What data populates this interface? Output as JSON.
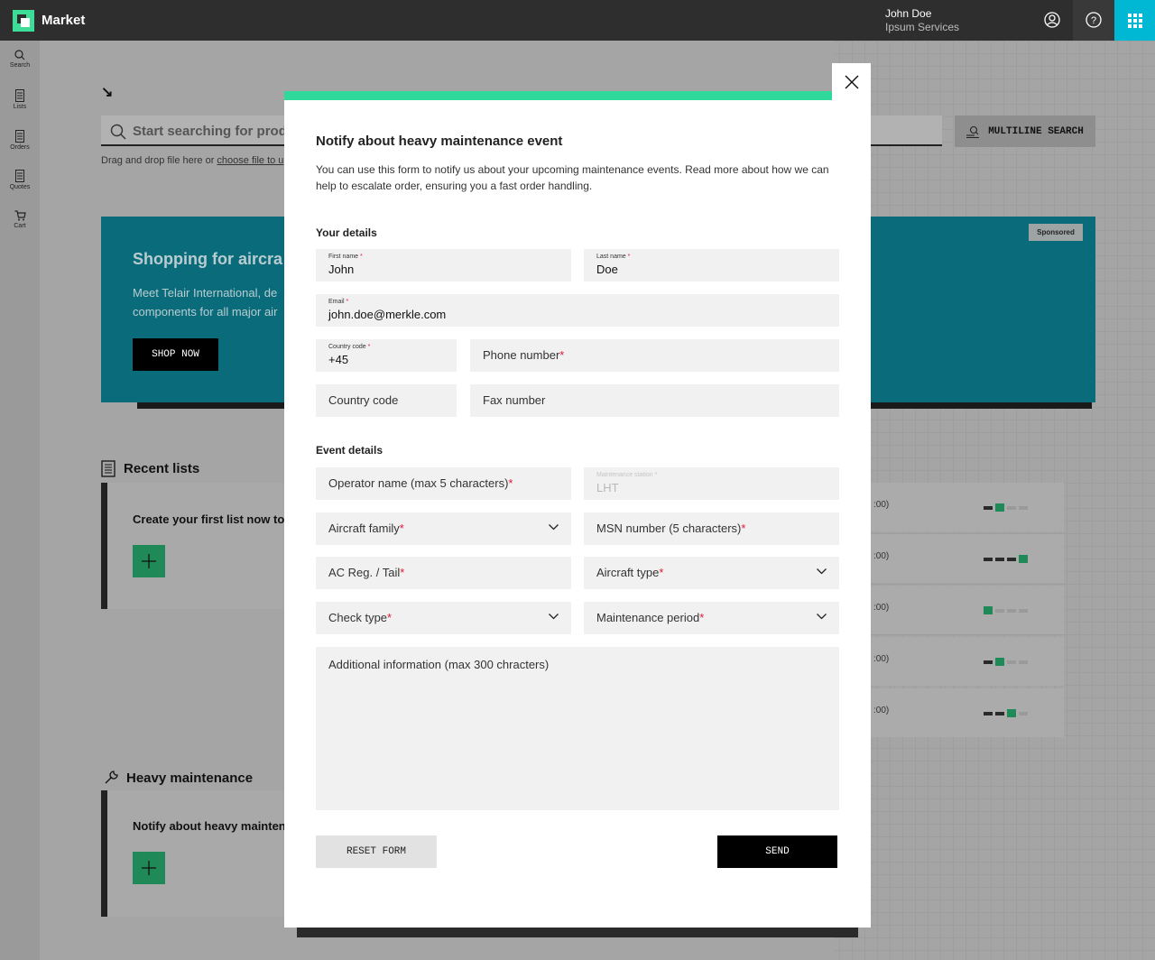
{
  "header": {
    "app_title": "Market",
    "user_name": "John Doe",
    "user_company": "Ipsum Services"
  },
  "sidebar": {
    "items": [
      {
        "label": "Search",
        "icon": "search-icon"
      },
      {
        "label": "Lists",
        "icon": "list-icon"
      },
      {
        "label": "Orders",
        "icon": "orders-icon"
      },
      {
        "label": "Quotes",
        "icon": "quotes-icon"
      },
      {
        "label": "Cart",
        "icon": "cart-icon"
      }
    ]
  },
  "background": {
    "search_placeholder": "Start searching for produ",
    "drag_text_prefix": "Drag and drop file here or ",
    "drag_link": "choose file to u",
    "multiline_label": "MULTILINE SEARCH",
    "promo_title": "Shopping for aircra",
    "promo_text": "Meet Telair International, de components for all major air",
    "shop_now": "SHOP NOW",
    "sponsored": "Sponsored",
    "recent_lists_title": "Recent lists",
    "recent_lists_card": "Create your first list now to g",
    "heavy_maintenance_title": "Heavy maintenance",
    "heavy_maintenance_card": "Notify about heavy maintena",
    "rows": [
      {
        "time": ":00)",
        "bars": [
          "dark",
          "green",
          "light",
          "light"
        ]
      },
      {
        "time": ":00)",
        "bars": [
          "dark",
          "dark",
          "dark",
          "green"
        ]
      },
      {
        "time": ":00)",
        "bars": [
          "green",
          "light",
          "light",
          "light"
        ]
      },
      {
        "time": ":00)",
        "bars": [
          "dark",
          "green",
          "light",
          "light"
        ]
      },
      {
        "time": ":00)",
        "bars": [
          "dark",
          "dark",
          "green",
          "light"
        ]
      }
    ]
  },
  "modal": {
    "title": "Notify about heavy maintenance event",
    "description": "You can use this form to notify us about your upcoming maintenance events. Read more about how we can help to escalate order, ensuring you a fast order handling.",
    "your_details_title": "Your details",
    "event_details_title": "Event details",
    "first_name": {
      "label": "First name",
      "value": "John"
    },
    "last_name": {
      "label": "Last name",
      "value": "Doe"
    },
    "email": {
      "label": "Email",
      "value": "john.doe@merkle.com"
    },
    "country_code": {
      "label": "Country code",
      "value": "+45"
    },
    "phone_number": {
      "placeholder": "Phone number"
    },
    "fax_country_code": {
      "placeholder": "Country code"
    },
    "fax_number": {
      "placeholder": "Fax number"
    },
    "operator_name": {
      "placeholder": "Operator name (max 5 characters)"
    },
    "maintenance_station": {
      "label": "Maintenance station",
      "value": "LHT"
    },
    "aircraft_family": {
      "placeholder": "Aircraft family"
    },
    "msn_number": {
      "placeholder": "MSN number (5 characters)"
    },
    "ac_reg": {
      "placeholder": "AC Reg. / Tail"
    },
    "aircraft_type": {
      "placeholder": "Aircraft type"
    },
    "check_type": {
      "placeholder": "Check type"
    },
    "maintenance_period": {
      "placeholder": "Maintenance period"
    },
    "additional_info": {
      "placeholder": "Additional information (max 300 chracters)"
    },
    "required_marker": "*",
    "reset_label": "RESET FORM",
    "send_label": "SEND"
  },
  "colors": {
    "accent": "#2fd99b",
    "required": "#e0193a",
    "apps_button": "#00b8d4",
    "promo": "#0a6b7a"
  }
}
